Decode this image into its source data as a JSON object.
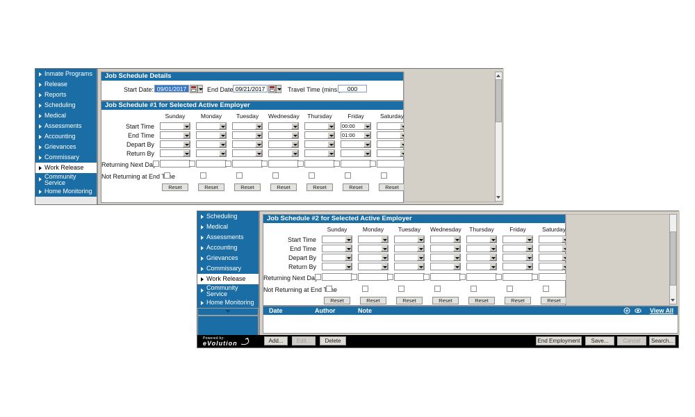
{
  "app": {
    "logo_line1": "Powered by:",
    "logo_line2": "eVolution"
  },
  "sidebar": {
    "items_top": [
      {
        "label": "Inmate Programs",
        "selected": false
      },
      {
        "label": "Release",
        "selected": false
      },
      {
        "label": "Reports",
        "selected": false
      },
      {
        "label": "Scheduling",
        "selected": false
      },
      {
        "label": "Medical",
        "selected": false
      },
      {
        "label": "Assessments",
        "selected": false
      },
      {
        "label": "Accounting",
        "selected": false
      },
      {
        "label": "Grievances",
        "selected": false
      },
      {
        "label": "Commissary",
        "selected": false
      },
      {
        "label": "Work Release",
        "selected": true
      },
      {
        "label": "Community Service",
        "selected": false
      },
      {
        "label": "Home Monitoring",
        "selected": false
      }
    ],
    "items_bottom": [
      {
        "label": "Scheduling",
        "selected": false
      },
      {
        "label": "Medical",
        "selected": false
      },
      {
        "label": "Assessments",
        "selected": false
      },
      {
        "label": "Accounting",
        "selected": false
      },
      {
        "label": "Grievances",
        "selected": false
      },
      {
        "label": "Commissary",
        "selected": false
      },
      {
        "label": "Work Release",
        "selected": true
      },
      {
        "label": "Community Service",
        "selected": false
      },
      {
        "label": "Home Monitoring",
        "selected": false
      }
    ]
  },
  "details_panel": {
    "title": "Job Schedule Details",
    "start_date_label": "Start Date:",
    "start_date_value": "09/01/2017",
    "end_date_label": "End Date:",
    "end_date_value": "09/21/2017",
    "travel_time_label": "Travel Time (mins.):",
    "travel_time_value": "000"
  },
  "schedule1": {
    "title": "Job Schedule #1 for Selected Active Employer",
    "days": [
      "Sunday",
      "Monday",
      "Tuesday",
      "Wednesday",
      "Thursday",
      "Friday",
      "Saturday"
    ],
    "rows": [
      {
        "label": "Start Time",
        "values": [
          "",
          "",
          "",
          "",
          "",
          "00:00",
          ""
        ]
      },
      {
        "label": "End Time",
        "values": [
          "",
          "",
          "",
          "",
          "",
          "01:00",
          ""
        ]
      },
      {
        "label": "Depart By",
        "values": [
          "",
          "",
          "",
          "",
          "",
          "",
          ""
        ]
      },
      {
        "label": "Return By",
        "values": [
          "",
          "",
          "",
          "",
          "",
          "",
          ""
        ]
      }
    ],
    "returning_next_day_label": "Returning Next Day",
    "returning_next_day_values": [
      "",
      "",
      "",
      "",
      "",
      "",
      ""
    ],
    "not_returning_label": "Not Returning at End Time",
    "reset_label": "Reset"
  },
  "schedule2": {
    "title": "Job Schedule #2 for Selected Active Employer",
    "days": [
      "Sunday",
      "Monday",
      "Tuesday",
      "Wednesday",
      "Thursday",
      "Friday",
      "Saturday"
    ],
    "rows": [
      {
        "label": "Start Time",
        "values": [
          "",
          "",
          "",
          "",
          "",
          "",
          ""
        ]
      },
      {
        "label": "End Time",
        "values": [
          "",
          "",
          "",
          "",
          "",
          "",
          ""
        ]
      },
      {
        "label": "Depart By",
        "values": [
          "",
          "",
          "",
          "",
          "",
          "",
          ""
        ]
      },
      {
        "label": "Return By",
        "values": [
          "",
          "",
          "",
          "",
          "",
          "",
          ""
        ]
      }
    ],
    "returning_next_day_label": "Returning Next Day",
    "returning_next_day_values": [
      "",
      "",
      "",
      "",
      "",
      "",
      ""
    ],
    "not_returning_label": "Not Returning at End Time",
    "reset_label": "Reset"
  },
  "notes_grid": {
    "columns": [
      "Date",
      "Author",
      "Note"
    ],
    "add_icon": "plus-circle-icon",
    "view_icon": "eye-icon",
    "view_all_label": "View All",
    "rows": []
  },
  "toolbar": {
    "add_label": "Add...",
    "edit_label": "Edit...",
    "delete_label": "Delete",
    "end_employment_label": "End Employment",
    "save_label": "Save...",
    "cancel_label": "Cancel",
    "search_label": "Search..."
  },
  "colors": {
    "accent_blue": "#1b6ea5",
    "selection_blue": "#3a76c4",
    "toolbar_black": "#000000",
    "panel_face": "#d4d0c8"
  }
}
